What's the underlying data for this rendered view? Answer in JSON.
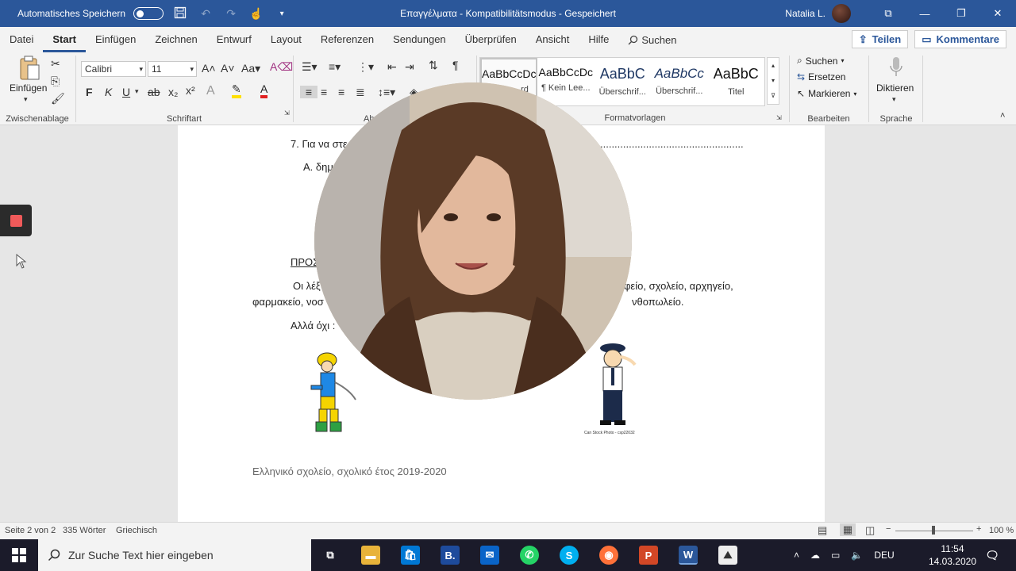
{
  "titlebar": {
    "autosave_label": "Automatisches Speichern",
    "title": "Επαγγέλματα  -  Kompatibilitätsmodus  -  Gespeichert",
    "user": "Natalia L.",
    "colors": {
      "bar": "#2b579a"
    }
  },
  "tabs": [
    {
      "label": "Datei"
    },
    {
      "label": "Start"
    },
    {
      "label": "Einfügen"
    },
    {
      "label": "Zeichnen"
    },
    {
      "label": "Entwurf"
    },
    {
      "label": "Layout"
    },
    {
      "label": "Referenzen"
    },
    {
      "label": "Sendungen"
    },
    {
      "label": "Überprüfen"
    },
    {
      "label": "Ansicht"
    },
    {
      "label": "Hilfe"
    },
    {
      "label": "Suchen"
    }
  ],
  "share": {
    "teilen": "Teilen",
    "kommentare": "Kommentare"
  },
  "ribbon": {
    "clipboard": {
      "paste": "Einfügen",
      "group": "Zwischenablage"
    },
    "font": {
      "name": "Calibri",
      "size": "11",
      "bold": "F",
      "italic": "K",
      "underline": "U",
      "group": "Schriftart"
    },
    "paragraph": {
      "group": "Ab"
    },
    "styles": {
      "group": "Formatvorlagen",
      "items": [
        {
          "preview": "AaBbCcDc",
          "name": "rd"
        },
        {
          "preview": "AaBbCcDc",
          "name": "¶ Kein Lee..."
        },
        {
          "preview": "AaBbC",
          "name": "Überschrif..."
        },
        {
          "preview": "AaBbCc",
          "name": "Überschrif..."
        },
        {
          "preview": "AaBbC",
          "name": "Titel"
        }
      ]
    },
    "editing": {
      "find": "Suchen",
      "replace": "Ersetzen",
      "select": "Markieren",
      "group": "Bearbeiten"
    },
    "voice": {
      "dictate": "Diktieren",
      "group": "Sprache"
    }
  },
  "document": {
    "line1": "7. Για να στε",
    "line1_dots": "..................................................",
    "line2": "Α. δημ",
    "heading": "ΠΡΟΣ",
    "p1_start": "Οι λέξ",
    "p1_end": "φείο, σχολείο, αρχηγείο,",
    "p2_start": "φαρμακείο, νοσ",
    "p2_end": "νθοπωλείο.",
    "p3": "Αλλά όχι :",
    "image_caption": "Can Stock Photo - csp22032",
    "footer": "Ελληνικό σχολείο, σχολικό έτος 2019-2020"
  },
  "statusbar": {
    "page": "Seite 2 von 2",
    "words": "335 Wörter",
    "language": "Griechisch",
    "zoom": "100 %"
  },
  "taskbar": {
    "search_placeholder": "Zur Suche Text hier eingeben",
    "lang": "DEU",
    "time": "11:54",
    "date": "14.03.2020"
  }
}
